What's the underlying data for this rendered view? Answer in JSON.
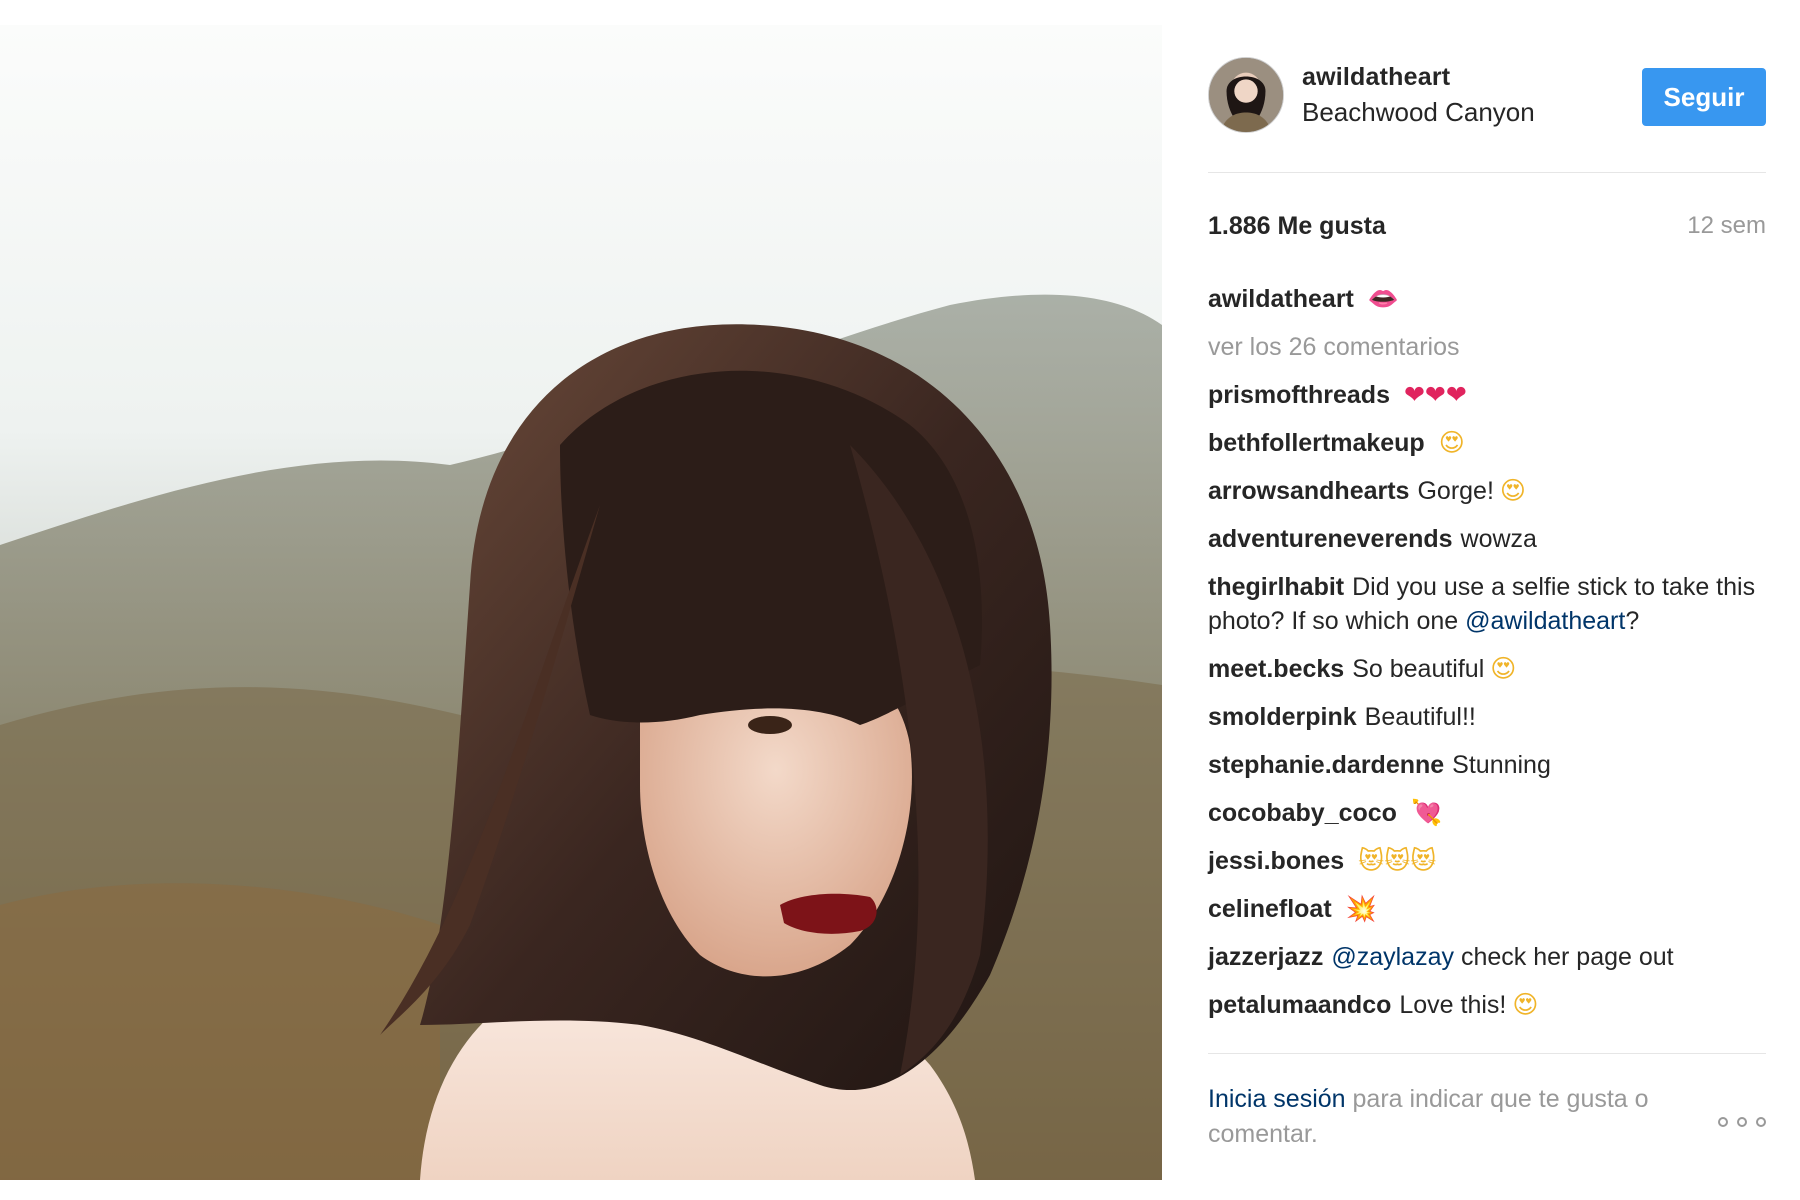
{
  "photo": {
    "icon": "portrait-photo"
  },
  "header": {
    "avatar_icon": "profile-avatar",
    "username": "awildatheart",
    "location": "Beachwood Canyon",
    "follow_label": "Seguir"
  },
  "stats": {
    "likes": "1.886 Me gusta",
    "time_ago": "12 sem"
  },
  "caption": {
    "user": "awildatheart",
    "emoji": "👄"
  },
  "view_all": "ver los 26 comentarios",
  "comments": [
    {
      "user": "prismofthreads",
      "emoji": "❤❤❤"
    },
    {
      "user": "bethfollertmakeup",
      "emoji": "😍"
    },
    {
      "user": "arrowsandhearts",
      "text": "Gorge!",
      "emoji": "😍"
    },
    {
      "user": "adventureneverends",
      "text": "wowza"
    },
    {
      "user": "thegirlhabit",
      "text": "Did you use a selfie stick to take this photo? If so which one",
      "mention": "@awildatheart",
      "after": "?"
    },
    {
      "user": "meet.becks",
      "text": "So beautiful",
      "emoji": "😍"
    },
    {
      "user": "smolderpink",
      "text": "Beautiful!!"
    },
    {
      "user": "stephanie.dardenne",
      "text": "Stunning"
    },
    {
      "user": "cocobaby_coco",
      "emoji": "💘"
    },
    {
      "user": "jessi.bones",
      "emoji": "😻😻😻"
    },
    {
      "user": "celinefloat",
      "emoji": "💥"
    },
    {
      "user": "jazzerjazz",
      "mention": "@zaylazay",
      "text": "check her page out"
    },
    {
      "user": "petalumaandco",
      "text": "Love this!",
      "emoji": "😍"
    }
  ],
  "footer": {
    "login_label": "Inicia sesión",
    "rest": " para indicar que te gusta o comentar.",
    "more_icon": "more-options-icon"
  },
  "colors": {
    "accent": "#3897f0",
    "link": "#003569",
    "muted": "#999999",
    "text": "#262626"
  }
}
